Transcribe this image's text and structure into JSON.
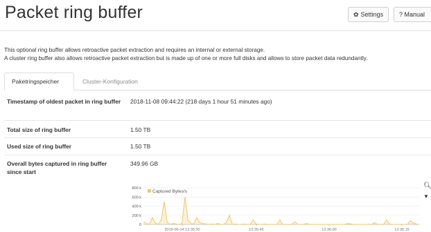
{
  "header": {
    "title": "Packet ring buffer",
    "settings_label": "Settings",
    "manual_label": "? Manual"
  },
  "description": {
    "line1": "This optional ring buffer allows retroactive packet extraction and requires an internal or external storage.",
    "line2": "A cluster ring buffer also allows retroactive packet extraction but is made up of one or more full disks and allows to store packet data redundantly."
  },
  "tabs": [
    {
      "label": "Paketringspeicher",
      "active": true
    },
    {
      "label": "Cluster-Konfiguration",
      "active": false
    }
  ],
  "rows": [
    {
      "label": "Timestamp of oldest packet in ring buffer",
      "value": "2018-11-08 09:44:22 (218 days 1 hour 51 minutes ago)"
    },
    {
      "label": "Total size of ring buffer",
      "value": "1.50 TB"
    },
    {
      "label": "Used size of ring buffer",
      "value": "1.50 TB"
    },
    {
      "label": "Overall bytes captured in ring buffer since start",
      "value": "349.96 GB"
    }
  ],
  "chart_data": {
    "type": "area",
    "series": [
      {
        "name": "Captured Bytes/s",
        "color": "#f2c66b",
        "values": [
          60000,
          20000,
          0,
          150000,
          30000,
          0,
          100000,
          500000,
          50000,
          0,
          20000,
          10000,
          0,
          20000,
          600000,
          100000,
          20000,
          10000,
          150000,
          40000,
          20000,
          10000,
          0,
          10000,
          0,
          20000,
          0,
          0,
          50000,
          200000,
          0,
          10000,
          0,
          0,
          10000,
          0,
          0,
          100000,
          10000,
          0,
          0,
          10000,
          0,
          0,
          0,
          0,
          100000,
          0,
          0,
          0,
          0,
          60000,
          0,
          0,
          0,
          20000,
          0,
          0,
          0,
          0,
          0,
          0,
          0,
          0,
          0,
          0,
          0,
          0,
          0,
          20000,
          10000,
          0,
          0,
          0,
          0,
          0,
          0,
          0,
          40000,
          0,
          0,
          0,
          100000,
          10000,
          0,
          0,
          0,
          0,
          0,
          0,
          80000,
          30000,
          10000,
          0
        ]
      }
    ],
    "y_ticks": [
      "800 k",
      "600 k",
      "400 k",
      "200 k",
      "0"
    ],
    "ylim": [
      0,
      800000
    ],
    "x_ticks": [
      "2019-06-14 12:35:30",
      "12:35:45",
      "12:36:00",
      "12:36:15"
    ],
    "legend_position": "top-left",
    "grid": true
  },
  "chart_controls": {
    "zoom_icon": "magnifier-icon",
    "menu_icon": "caret-down-icon"
  }
}
